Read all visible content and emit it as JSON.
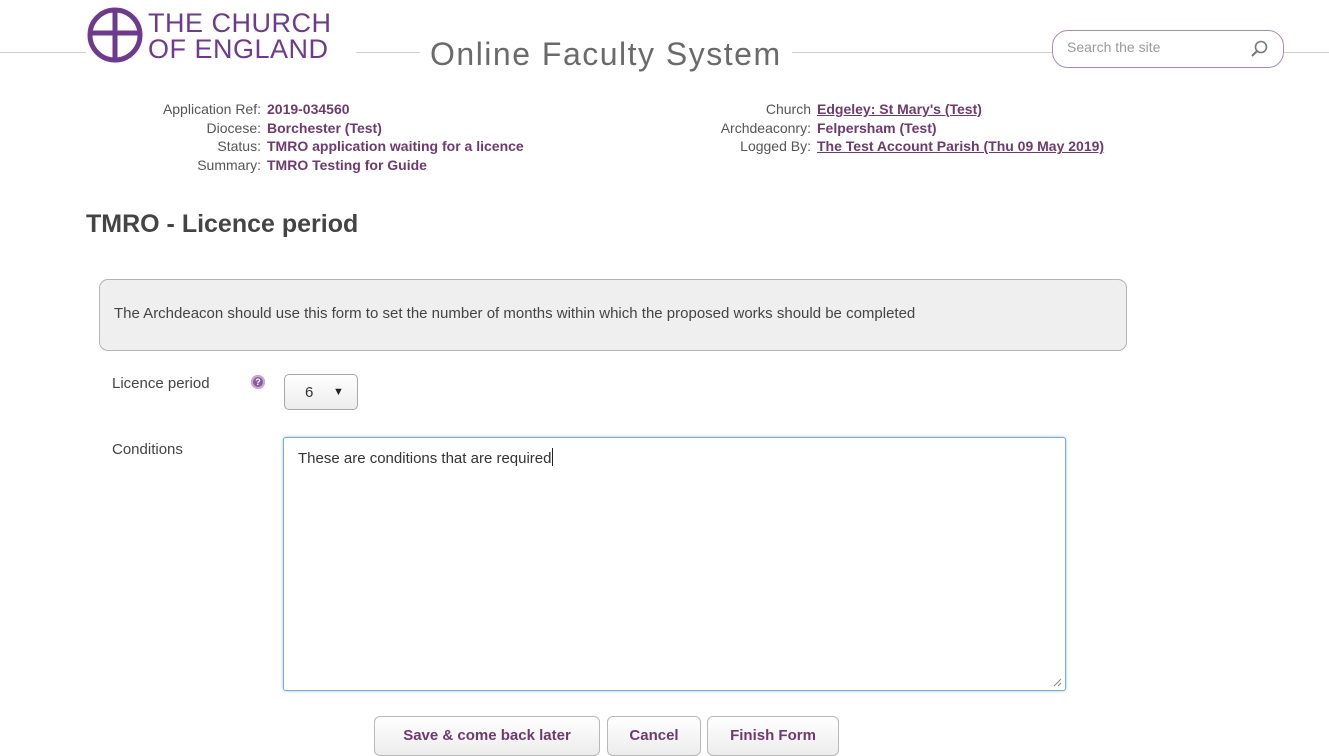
{
  "header": {
    "logo_line1": "THE CHURCH",
    "logo_line2": "OF ENGLAND",
    "site_title": "Online Faculty System",
    "search_placeholder": "Search the site",
    "brand_color": "#6e3a8e"
  },
  "application": {
    "left": [
      {
        "label": "Application Ref:",
        "value": "2019-034560"
      },
      {
        "label": "Diocese:",
        "value": "Borchester (Test)"
      },
      {
        "label": "Status:",
        "value": "TMRO application waiting for a licence"
      },
      {
        "label": "Summary:",
        "value": "TMRO Testing for Guide"
      }
    ],
    "right": [
      {
        "label": "Church",
        "value": "Edgeley: St Mary's (Test)"
      },
      {
        "label": "Archdeaconry:",
        "value": "Felpersham (Test)"
      },
      {
        "label": "Logged By:",
        "value": "The Test Account Parish (Thu 09 May 2019)"
      }
    ]
  },
  "page": {
    "heading": "TMRO - Licence period",
    "info": "The Archdeacon should use this form to set the number of months within which the proposed works should be completed"
  },
  "form": {
    "licence_label": "Licence period",
    "help_icon": "?",
    "licence_value": "6",
    "conditions_label": "Conditions",
    "conditions_value": "These are conditions that are required"
  },
  "buttons": {
    "save": "Save & come back later",
    "cancel": "Cancel",
    "finish": "Finish Form"
  }
}
